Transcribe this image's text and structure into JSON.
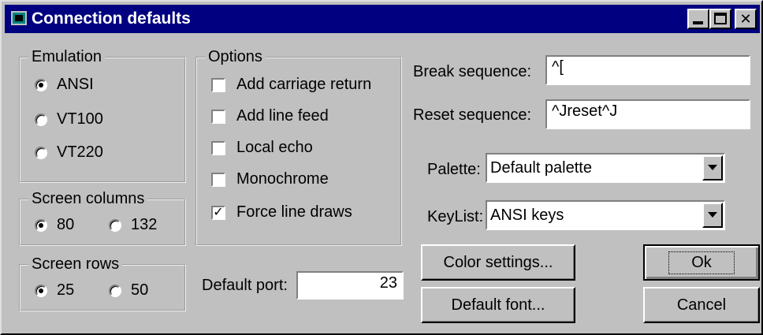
{
  "window": {
    "title": "Connection defaults"
  },
  "emulation": {
    "legend": "Emulation",
    "options": [
      "ANSI",
      "VT100",
      "VT220"
    ],
    "selected": "ANSI"
  },
  "screen_columns": {
    "legend": "Screen columns",
    "options": [
      "80",
      "132"
    ],
    "selected": "80"
  },
  "screen_rows": {
    "legend": "Screen rows",
    "options": [
      "25",
      "50"
    ],
    "selected": "25"
  },
  "options": {
    "legend": "Options",
    "items": [
      {
        "label": "Add carriage return",
        "checked": false
      },
      {
        "label": "Add line feed",
        "checked": false
      },
      {
        "label": "Local echo",
        "checked": false
      },
      {
        "label": "Monochrome",
        "checked": false
      },
      {
        "label": "Force line draws",
        "checked": true
      }
    ]
  },
  "default_port": {
    "label": "Default port:",
    "value": "23"
  },
  "break_sequence": {
    "label": "Break sequence:",
    "value": "^["
  },
  "reset_sequence": {
    "label": "Reset sequence:",
    "value": "^Jreset^J"
  },
  "palette": {
    "label": "Palette:",
    "value": "Default palette"
  },
  "keylist": {
    "label": "KeyList:",
    "value": "ANSI keys"
  },
  "buttons": {
    "color_settings": "Color settings...",
    "default_font": "Default font...",
    "ok": "Ok",
    "cancel": "Cancel"
  },
  "colors": {
    "title_bar": "#000080",
    "face": "#c0c0c0"
  }
}
